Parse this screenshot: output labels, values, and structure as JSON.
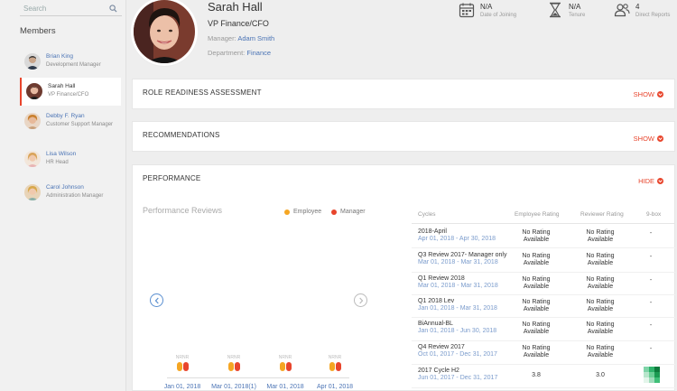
{
  "search": {
    "placeholder": "Search"
  },
  "members_title": "Members",
  "members": [
    {
      "name": "Brian King",
      "role": "Development Manager",
      "active": false
    },
    {
      "name": "Sarah Hall",
      "role": "VP Finance/CFO",
      "active": true
    },
    {
      "name": "Debby F. Ryan",
      "role": "Customer Support Manager",
      "active": false
    },
    {
      "name": "Lisa Wilson",
      "role": "HR Head",
      "active": false
    },
    {
      "name": "Carol Johnson",
      "role": "Administration Manager",
      "active": false
    }
  ],
  "profile": {
    "name": "Sarah Hall",
    "title": "VP Finance/CFO",
    "manager_label": "Manager:",
    "manager": "Adam Smith",
    "department_label": "Department:",
    "department": "Finance"
  },
  "stats": [
    {
      "value": "N/A",
      "label": "Date of Joining",
      "icon": "calendar-icon"
    },
    {
      "value": "N/A",
      "label": "Tenure",
      "icon": "hourglass-icon"
    },
    {
      "value": "4",
      "label": "Direct Reports",
      "icon": "people-icon"
    }
  ],
  "sections": {
    "role_readiness": {
      "title": "ROLE READINESS ASSESSMENT",
      "toggle": "SHOW"
    },
    "recommendations": {
      "title": "RECOMMENDATIONS",
      "toggle": "SHOW"
    },
    "performance": {
      "title": "PERFORMANCE",
      "toggle": "HIDE"
    }
  },
  "performance_reviews": {
    "title": "Performance Reviews",
    "legend": [
      {
        "label": "Employee",
        "color": "#f5a623"
      },
      {
        "label": "Manager",
        "color": "#e8452c"
      }
    ]
  },
  "colors": {
    "accent": "#e8452c",
    "link": "#4b74b5",
    "employee": "#f5a623",
    "manager": "#e8452c"
  },
  "chart_data": {
    "type": "bar",
    "categories": [
      "Jan 01, 2018",
      "Mar 01, 2018(1)",
      "Mar 01, 2018",
      "Apr 01, 2018"
    ],
    "bar_label": "NRNR",
    "series": [
      {
        "name": "Employee",
        "values": [
          null,
          null,
          null,
          null
        ]
      },
      {
        "name": "Manager",
        "values": [
          null,
          null,
          null,
          null
        ]
      }
    ]
  },
  "table": {
    "headers": [
      "Cycles",
      "Employee Rating",
      "Reviewer Rating",
      "9-box"
    ],
    "rows": [
      {
        "cycle": "2018-April",
        "dates": "Apr 01, 2018 - Apr 30, 2018",
        "employee_rating": "No Rating Available",
        "reviewer_rating": "No Rating Available",
        "ninebox": "-"
      },
      {
        "cycle": "Q3 Review 2017- Manager only",
        "dates": "Mar 01, 2018 - Mar 31, 2018",
        "employee_rating": "No Rating Available",
        "reviewer_rating": "No Rating Available",
        "ninebox": "-"
      },
      {
        "cycle": "Q1 Review 2018",
        "dates": "Mar 01, 2018 - Mar 31, 2018",
        "employee_rating": "No Rating Available",
        "reviewer_rating": "No Rating Available",
        "ninebox": "-"
      },
      {
        "cycle": "Q1 2018 Lev",
        "dates": "Jan 01, 2018 - Mar 31, 2018",
        "employee_rating": "No Rating Available",
        "reviewer_rating": "No Rating Available",
        "ninebox": "-"
      },
      {
        "cycle": "BiAnnual-BL",
        "dates": "Jan 01, 2018 - Jun 30, 2018",
        "employee_rating": "No Rating Available",
        "reviewer_rating": "No Rating Available",
        "ninebox": "-"
      },
      {
        "cycle": "Q4 Review 2017",
        "dates": "Oct 01, 2017 - Dec 31, 2017",
        "employee_rating": "No Rating Available",
        "reviewer_rating": "No Rating Available",
        "ninebox": "-"
      },
      {
        "cycle": "2017 Cycle H2",
        "dates": "Jun 01, 2017 - Dec 31, 2017",
        "employee_rating": "3.8",
        "reviewer_rating": "3.0",
        "ninebox": ""
      }
    ]
  }
}
